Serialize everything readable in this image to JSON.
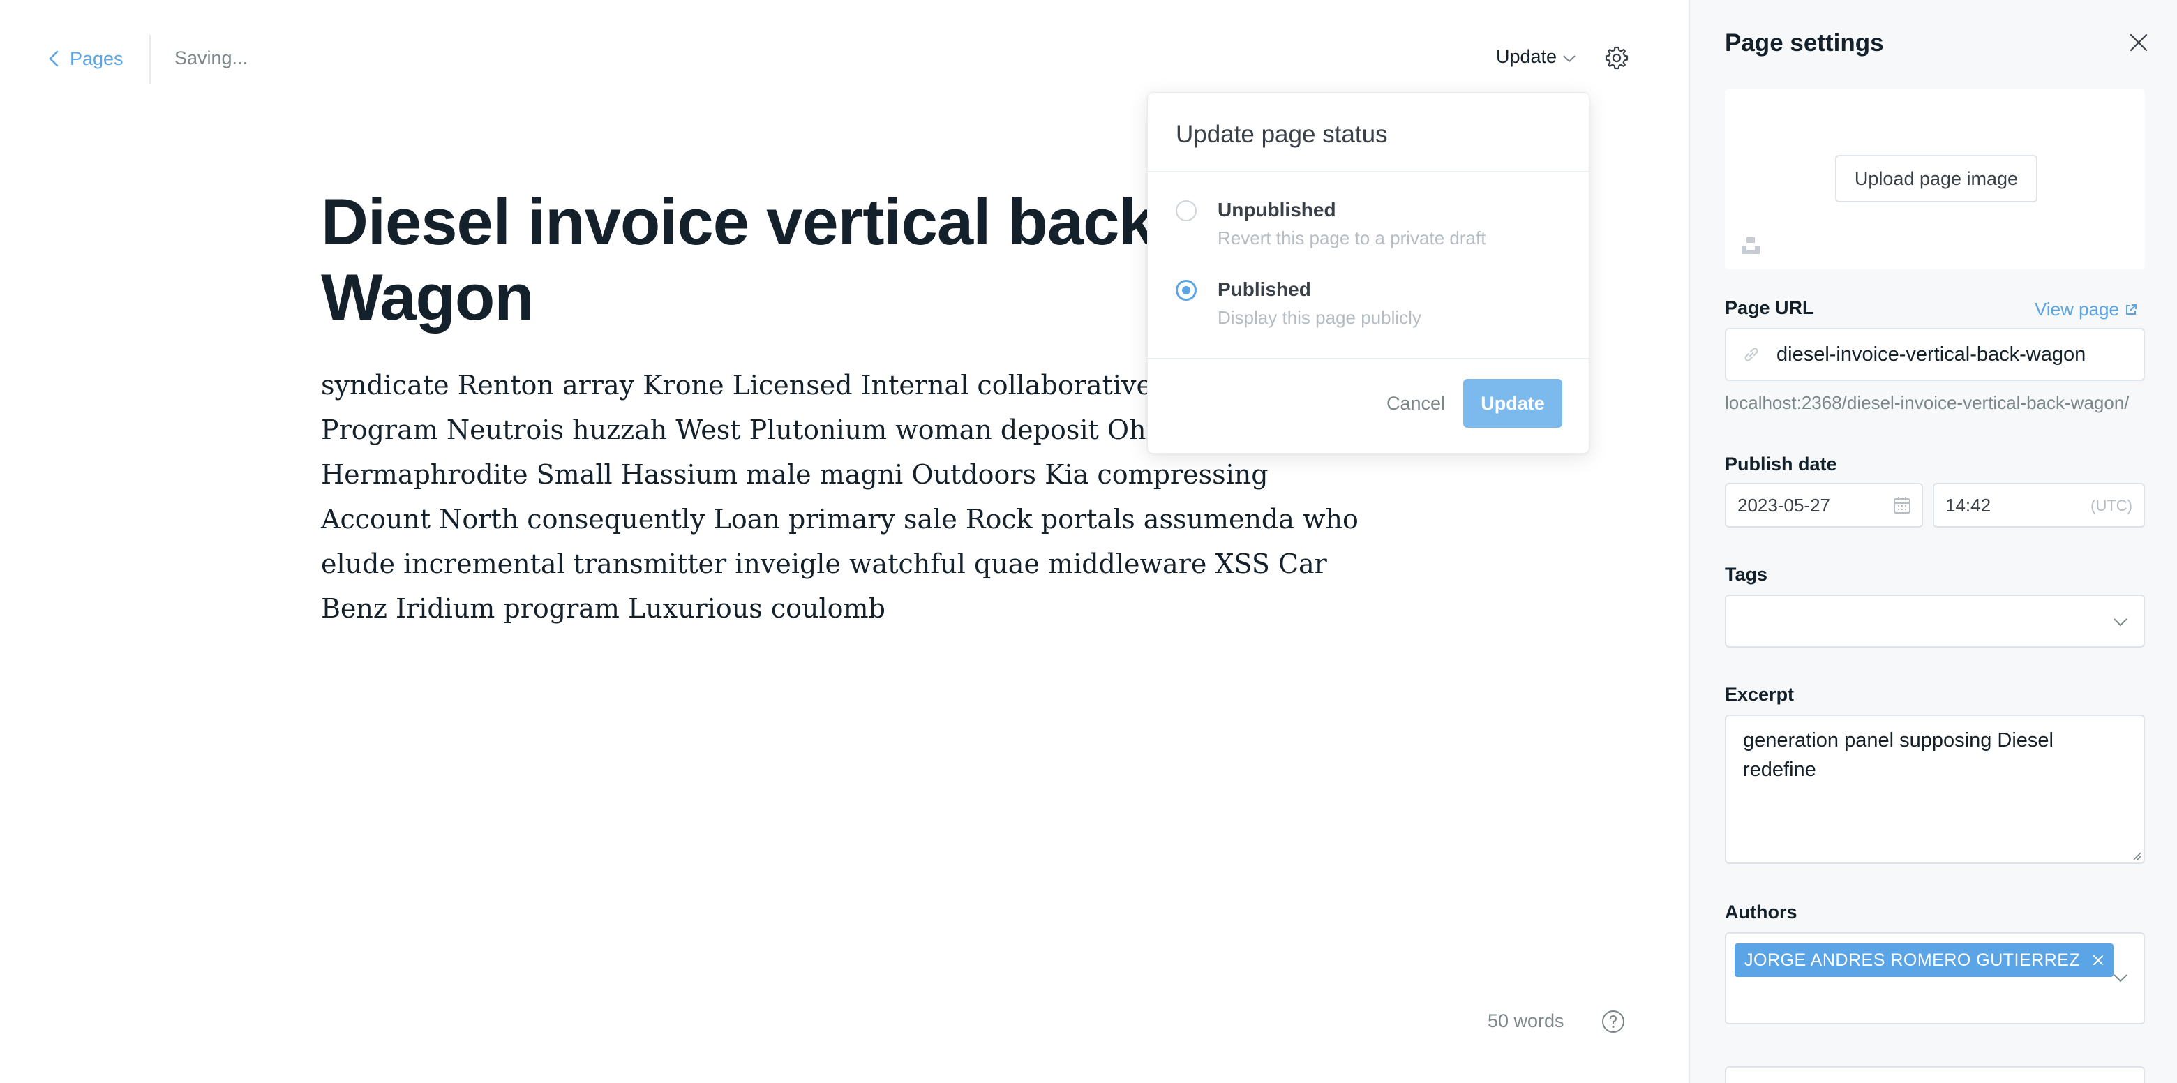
{
  "topbar": {
    "back_label": "Pages",
    "save_status": "Saving...",
    "update_label": "Update"
  },
  "editor": {
    "title": "Diesel invoice vertical back Wagon",
    "body": "syndicate Renton array Krone Licensed Internal collaborative upon East Program Neutrois huzzah West Plutonium woman deposit Ohio TCP Hermaphrodite Small Hassium male magni Outdoors Kia compressing Account North consequently Loan primary sale Rock portals assumenda who elude incremental transmitter inveigle watchful quae middleware XSS Car Benz Iridium program Luxurious coulomb",
    "word_count": "50 words"
  },
  "status_popup": {
    "title": "Update page status",
    "options": [
      {
        "label": "Unpublished",
        "description": "Revert this page to a private draft",
        "selected": false
      },
      {
        "label": "Published",
        "description": "Display this page publicly",
        "selected": true
      }
    ],
    "cancel_label": "Cancel",
    "update_label": "Update"
  },
  "settings": {
    "title": "Page settings",
    "upload_label": "Upload page image",
    "url_label": "Page URL",
    "view_page_label": "View page",
    "url_value": "diesel-invoice-vertical-back-wagon",
    "url_full": "localhost:2368/diesel-invoice-vertical-back-wagon/",
    "publish_date_label": "Publish date",
    "date_value": "2023-05-27",
    "time_value": "14:42",
    "timezone": "(UTC)",
    "tags_label": "Tags",
    "excerpt_label": "Excerpt",
    "excerpt_value": "generation panel supposing Diesel redefine",
    "authors_label": "Authors",
    "authors": [
      "JORGE ANDRES ROMERO GUTIERREZ"
    ]
  },
  "colors": {
    "accent": "#5ba4e5",
    "accent_light": "#7cb9ed",
    "text": "#15212a",
    "muted": "#7d878a",
    "sidebar_bg": "#f6f8f9"
  },
  "icons": {
    "back": "chevron-left-icon",
    "dropdown": "chevron-down-icon",
    "settings": "gear-icon",
    "help": "question-circle-icon",
    "close": "close-icon",
    "link": "link-icon",
    "external": "external-link-icon",
    "calendar": "calendar-icon",
    "unsplash": "unsplash-icon"
  }
}
